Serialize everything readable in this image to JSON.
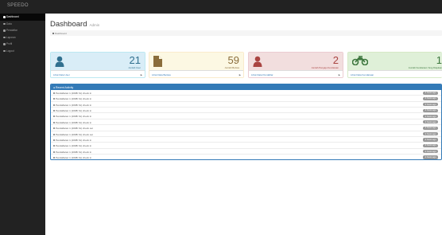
{
  "app": {
    "brand": "SPEEDO"
  },
  "sidebar": {
    "items": [
      {
        "label": "Dashboard",
        "active": true
      },
      {
        "label": "Data"
      },
      {
        "label": "Pendaftar"
      },
      {
        "label": "Laporan"
      },
      {
        "label": "Profil"
      },
      {
        "label": "Logout"
      }
    ]
  },
  "header": {
    "title": "Dashboard",
    "subtitle": "Admin"
  },
  "breadcrumb": {
    "label": "Dashboard"
  },
  "cards": [
    {
      "value": "21",
      "caption": "Jumlah User",
      "link": "Lihat Data User",
      "icon": "user-icon"
    },
    {
      "value": "59",
      "caption": "Jumlah Berkas",
      "link": "Lihat Data Berkas",
      "icon": "file-icon"
    },
    {
      "value": "2",
      "caption": "Jumlah Pengaju Kendaraan",
      "link": "Lihat Data Pendaftar",
      "icon": "user-icon"
    },
    {
      "value": "1",
      "caption": "Jumlah Kendaraan Yang Diajukan",
      "link": "Lihat Data Kendaraan",
      "icon": "motorcycle-icon"
    }
  ],
  "activity": {
    "title": "Recent Activity",
    "rows": [
      {
        "text": "Pendaftaran 1 (2008/ 0x) check in",
        "badge": "2 hours ago"
      },
      {
        "text": "Pendaftaran 1 (2008/ 0x) check in",
        "badge": "2 hours ago"
      },
      {
        "text": "Pendaftaran 1 (2008/ 0x) check in",
        "badge": "2 hours ago"
      },
      {
        "text": "Pendaftaran 1 (2008/ 0x) check in",
        "badge": "2 hours ago"
      },
      {
        "text": "Pendaftaran 1 (2008/ 0x) check in",
        "badge": "2 hours ago"
      },
      {
        "text": "Pendaftaran 1 (2008/ 0x) check in",
        "badge": "2 hours ago"
      },
      {
        "text": "Pendaftaran 1 (2008/ 0x) check out",
        "badge": "2 hours ago"
      },
      {
        "text": "Pendaftaran 1 (2008/ 0x) check out",
        "badge": "2 hours ago"
      },
      {
        "text": "Pendaftaran 1 (2008/ 0x) check in",
        "badge": "2 hours ago"
      },
      {
        "text": "Pendaftaran 1 (2008/ 0x) check in",
        "badge": "2 hours ago"
      },
      {
        "text": "Pendaftaran 1 (2008/ 0x) check in",
        "badge": "2 hours ago"
      },
      {
        "text": "Pendaftaran 1 (2008/ 0x) check in",
        "badge": "2 hours ago"
      }
    ]
  }
}
